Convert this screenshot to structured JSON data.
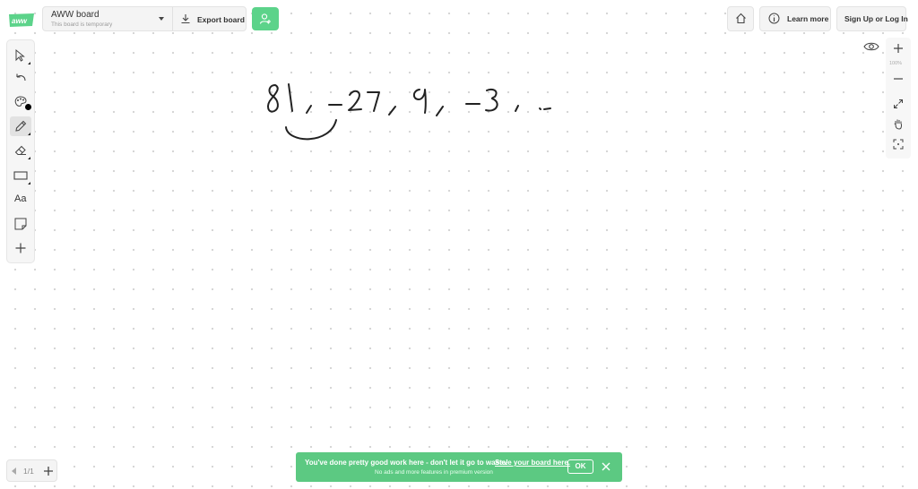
{
  "header": {
    "board_name": "AWW board",
    "board_status": "This board is temporary",
    "export_label": "Export board",
    "learn_more_label": "Learn more",
    "signup_label": "Sign Up or Log In"
  },
  "toolbar": {
    "tools": [
      "select",
      "undo",
      "color-palette",
      "pencil",
      "eraser",
      "rectangle",
      "text",
      "sticky-note",
      "add"
    ],
    "text_tool_label": "Aa",
    "active_tool": "pencil",
    "current_color": "#000000"
  },
  "zoom": {
    "level": "100%"
  },
  "pager": {
    "label": "1/1"
  },
  "banner": {
    "message": "You've done pretty good work here - don't let it go to waste!",
    "link": "Save your board here.",
    "sub": "No ads and more features in premium version",
    "ok_label": "OK"
  },
  "canvas": {
    "handwritten_text": "81, -27, 9, -3, .."
  },
  "colors": {
    "accent": "#5cd38a",
    "banner": "#5cc982"
  }
}
